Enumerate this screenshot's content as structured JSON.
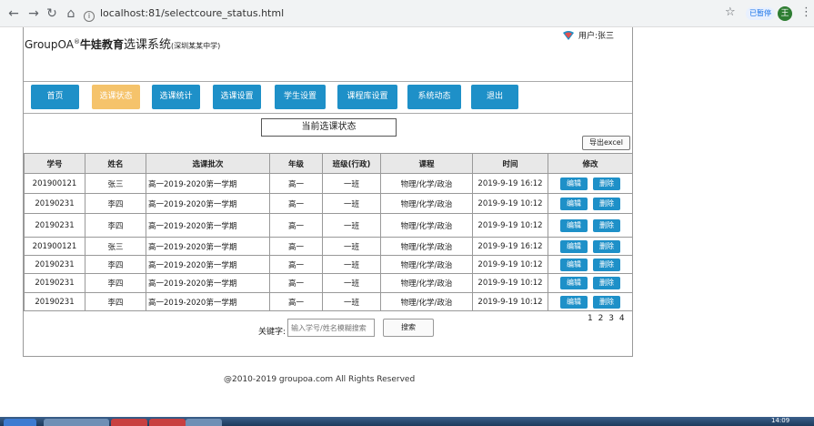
{
  "browser": {
    "url": "localhost:81/selectcoure_status.html",
    "paused_label": "已暂停",
    "profile_initial": "王"
  },
  "header": {
    "brand": "GroupOA",
    "brand_sup": "®",
    "brand_cn": "牛娃教育",
    "system": "选课系统",
    "school": "(深圳某某中学)",
    "user_label": "用户:张三"
  },
  "nav": [
    "首页",
    "选课状态",
    "选课统计",
    "选课设置",
    "学生设置",
    "课程库设置",
    "系统动态",
    "退出"
  ],
  "main": {
    "title": "当前选课状态",
    "export_label": "导出excel"
  },
  "table": {
    "headers": [
      "学号",
      "姓名",
      "选课批次",
      "年级",
      "班级(行政)",
      "课程",
      "时间",
      "修改"
    ],
    "edit_label": "编辑",
    "delete_label": "删除",
    "rows": [
      [
        "201900121",
        "张三",
        "高一2019-2020第一学期",
        "高一",
        "一班",
        "物理/化学/政治",
        "2019-9-19 16:12"
      ],
      [
        "20190231",
        "李四",
        "高一2019-2020第一学期",
        "高一",
        "一班",
        "物理/化学/政治",
        "2019-9-19 10:12"
      ],
      [
        "20190231",
        "李四",
        "高一2019-2020第一学期",
        "高一",
        "一班",
        "物理/化学/政治",
        "2019-9-19 10:12"
      ],
      [
        "201900121",
        "张三",
        "高一2019-2020第一学期",
        "高一",
        "一班",
        "物理/化学/政治",
        "2019-9-19 16:12"
      ],
      [
        "20190231",
        "李四",
        "高一2019-2020第一学期",
        "高一",
        "一班",
        "物理/化学/政治",
        "2019-9-19 10:12"
      ],
      [
        "20190231",
        "李四",
        "高一2019-2020第一学期",
        "高一",
        "一班",
        "物理/化学/政治",
        "2019-9-19 10:12"
      ],
      [
        "20190231",
        "李四",
        "高一2019-2020第一学期",
        "高一",
        "一班",
        "物理/化学/政治",
        "2019-9-19 10:12"
      ]
    ]
  },
  "pagination": [
    "1",
    "2",
    "3",
    "4"
  ],
  "search": {
    "label": "关键字:",
    "placeholder": "输入学号/姓名模糊搜索",
    "button_label": "搜索"
  },
  "footer": "@2010-2019 groupoa.com  All Rights Reserved",
  "taskbar": {
    "clock": "14:09"
  },
  "colors": {
    "primary": "#1e90c8",
    "active_nav": "#f5c36b"
  }
}
